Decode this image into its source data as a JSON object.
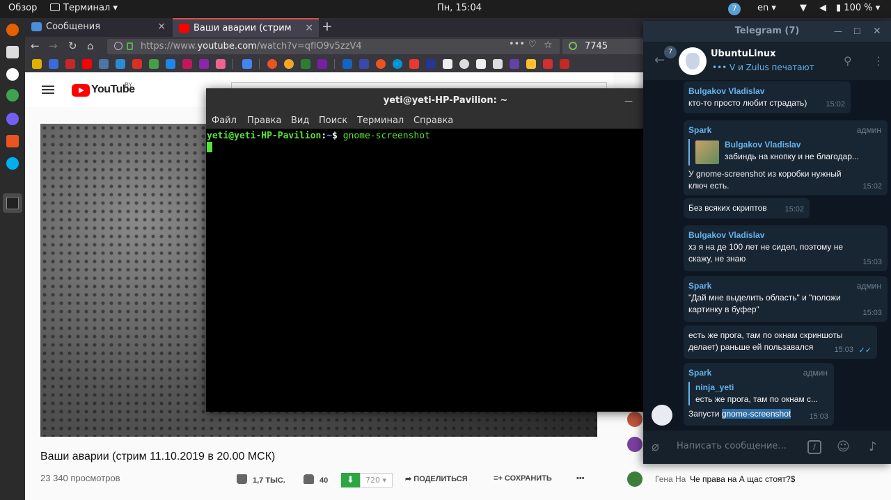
{
  "topbar": {
    "overview": "Обзор",
    "app_name": "Терминал ▾",
    "clock": "Пн, 15:04",
    "telegram_badge": "7",
    "lang": "en ▾",
    "battery": "100 % ▾"
  },
  "browser": {
    "tabs": [
      {
        "label": "Сообщения",
        "close": "×"
      },
      {
        "label": "Ваши аварии (стрим",
        "close": "×"
      }
    ],
    "new_tab": "+",
    "url_scheme": "https://www.",
    "url_host": "youtube.com",
    "url_path": "/watch?v=qfIO9v5zzV4",
    "url_actions": "•••",
    "zoom_value": "7745"
  },
  "youtube": {
    "logo": "YouTube",
    "logo_country": "BY",
    "video_title": "Ваши аварии (стрим 11.10.2019 в 20.00 МСК)",
    "views": "23 340 просмотров",
    "likes": "1,7 ТЫС.",
    "dislikes": "40",
    "download_count": "720 ▾",
    "share": "ПОДЕЛИТЬСЯ",
    "save": "СОХРАНИТЬ",
    "more": "•••",
    "chat_last": {
      "name": "Гена На",
      "text": "Че права на А щас стоят?$"
    }
  },
  "terminal": {
    "title": "yeti@yeti-HP-Pavilion: ~",
    "menu": [
      "Файл",
      "Правка",
      "Вид",
      "Поиск",
      "Терминал",
      "Справка"
    ],
    "prompt_user": "yeti@yeti-HP-Pavilion",
    "prompt_sep": ":",
    "prompt_path": "~",
    "prompt_symbol": "$ ",
    "command": "gnome-screenshot"
  },
  "telegram": {
    "title": "Telegram (7)",
    "unread": "7",
    "chat_name": "UbuntuLinux",
    "chat_status": "••• V и Zulus печатают",
    "compose_placeholder": "Написать сообщение...",
    "messages": [
      {
        "author": "Bulgakov Vladislav",
        "role": "",
        "text": "кто-то просто любит страдать)",
        "time": "15:02"
      },
      {
        "author": "Spark",
        "role": "админ",
        "reply_author": "Bulgakov Vladislav",
        "reply_text": "забиндь на кнопку и не благодар...",
        "text1": "У gnome-screenshot из коробки нужный",
        "text2": "ключ есть.",
        "time": "15:02"
      },
      {
        "author": "",
        "role": "",
        "text": "Без всяких скриптов",
        "time": "15:02"
      },
      {
        "author": "Bulgakov Vladislav",
        "role": "",
        "text1": "хз я на де 100 лет не сидел, поэтому не",
        "text2": "скажу, не знаю",
        "time": "15:03"
      },
      {
        "author": "Spark",
        "role": "админ",
        "text1": "\"Дай мне выделить область\" и \"положи",
        "text2": "картинку в буфер\"",
        "time": "15:03"
      },
      {
        "author": "",
        "role": "",
        "text1": "есть же прога, там по окнам скриншоты",
        "text2": "делает) раньше ей пользавался",
        "time": "15:03",
        "checks": "✓✓"
      },
      {
        "author": "Spark",
        "role": "админ",
        "reply_author": "ninja_yeti",
        "reply_text": "есть же прога, там по окнам с...",
        "text_prefix": "Запусти ",
        "text_highlight": "gnome-screenshot",
        "time": "15:03"
      }
    ]
  }
}
